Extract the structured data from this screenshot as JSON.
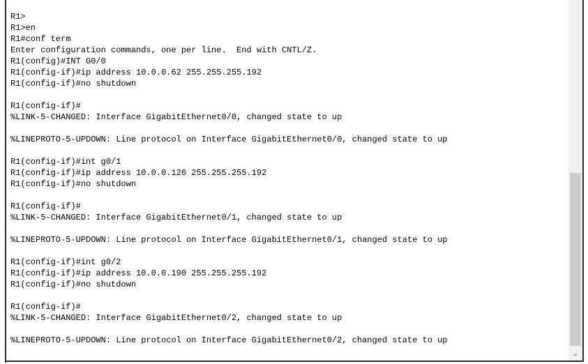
{
  "terminal": {
    "lines": [
      "R1>",
      "R1>en",
      "R1#conf term",
      "Enter configuration commands, one per line.  End with CNTL/Z.",
      "R1(config)#INT G0/0",
      "R1(config-if)#ip address 10.0.0.62 255.255.255.192",
      "R1(config-if)#no shutdown",
      "",
      "R1(config-if)#",
      "%LINK-5-CHANGED: Interface GigabitEthernet0/0, changed state to up",
      "",
      "%LINEPROTO-5-UPDOWN: Line protocol on Interface GigabitEthernet0/0, changed state to up",
      "",
      "R1(config-if)#int g0/1",
      "R1(config-if)#ip address 10.0.0.126 255.255.255.192",
      "R1(config-if)#no shutdown",
      "",
      "R1(config-if)#",
      "%LINK-5-CHANGED: Interface GigabitEthernet0/1, changed state to up",
      "",
      "%LINEPROTO-5-UPDOWN: Line protocol on Interface GigabitEthernet0/1, changed state to up",
      "",
      "R1(config-if)#int g0/2",
      "R1(config-if)#ip address 10.0.0.190 255.255.255.192",
      "R1(config-if)#no shutdown",
      "",
      "R1(config-if)#",
      "%LINK-5-CHANGED: Interface GigabitEthernet0/2, changed state to up",
      "",
      "%LINEPROTO-5-UPDOWN: Line protocol on Interface GigabitEthernet0/2, changed state to up"
    ]
  },
  "scrollbar": {
    "down_arrow": "⌄",
    "down_icon": "chevron-down-icon",
    "scroll_position_fraction": 1.0
  },
  "colors": {
    "text": "#000000",
    "background": "#ffffff",
    "scroll_track": "#f0f0f0",
    "scroll_thumb": "#cdcdcd"
  }
}
